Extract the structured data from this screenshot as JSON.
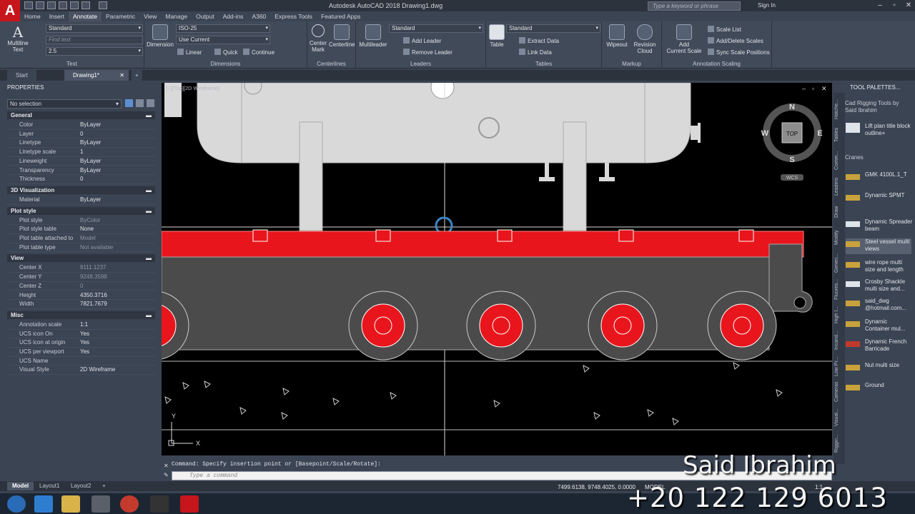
{
  "app": {
    "title": "Autodesk AutoCAD 2018    Drawing1.dwg",
    "logo": "A",
    "search_placeholder": "Type a keyword or phrase",
    "sign_in": "Sign In"
  },
  "ribbon_tabs": [
    "Home",
    "Insert",
    "Annotate",
    "Parametric",
    "View",
    "Manage",
    "Output",
    "Add-ins",
    "A360",
    "Express Tools",
    "Featured Apps"
  ],
  "ribbon": {
    "text": {
      "big_label": "Multiline\nText",
      "style": "Standard",
      "find": "Find text",
      "height": "2.5",
      "panel": "Text"
    },
    "dimensions": {
      "big_label": "Dimension",
      "style": "ISO-25",
      "layer": "Use Current",
      "linear": "Linear",
      "quick": "Quick",
      "continue": "Continue",
      "panel": "Dimensions"
    },
    "centerlines": {
      "mark": "Center\nMark",
      "centerline": "Centerline",
      "panel": "Centerlines"
    },
    "leaders": {
      "multileader": "Multileader",
      "style": "Standard",
      "add": "Add Leader",
      "remove": "Remove Leader",
      "panel": "Leaders"
    },
    "tables": {
      "table": "Table",
      "style": "Standard",
      "extract": "Extract Data",
      "link": "Link Data",
      "panel": "Tables"
    },
    "markup": {
      "wipeout": "Wipeout",
      "revcloud": "Revision\nCloud",
      "panel": "Markup"
    },
    "scaling": {
      "add": "Add\nCurrent Scale",
      "list": "Scale List",
      "adddel": "Add/Delete Scales",
      "sync": "Sync Scale Positions",
      "panel": "Annotation Scaling"
    }
  },
  "doc_tabs": {
    "start": "Start",
    "drawing": "Drawing1*"
  },
  "properties": {
    "header": "PROPERTIES",
    "selection": "No selection",
    "sections": [
      {
        "title": "General",
        "rows": [
          [
            "Color",
            "ByLayer"
          ],
          [
            "Layer",
            "0"
          ],
          [
            "Linetype",
            "ByLayer"
          ],
          [
            "Linetype scale",
            "1"
          ],
          [
            "Lineweight",
            "ByLayer"
          ],
          [
            "Transparency",
            "ByLayer"
          ],
          [
            "Thickness",
            "0"
          ]
        ]
      },
      {
        "title": "3D Visualization",
        "rows": [
          [
            "Material",
            "ByLayer"
          ]
        ]
      },
      {
        "title": "Plot style",
        "rows": [
          [
            "Plot style",
            "ByColor"
          ],
          [
            "Plot style table",
            "None"
          ],
          [
            "Plot table attached to",
            "Model"
          ],
          [
            "Plot table type",
            "Not available"
          ]
        ]
      },
      {
        "title": "View",
        "rows": [
          [
            "Center X",
            "8111.1237"
          ],
          [
            "Center Y",
            "9248.3598"
          ],
          [
            "Center Z",
            "0"
          ],
          [
            "Height",
            "4350.3716"
          ],
          [
            "Width",
            "7821.7679"
          ]
        ]
      },
      {
        "title": "Misc",
        "rows": [
          [
            "Annotation scale",
            "1:1"
          ],
          [
            "UCS icon On",
            "Yes"
          ],
          [
            "UCS icon at origin",
            "Yes"
          ],
          [
            "UCS per viewport",
            "Yes"
          ],
          [
            "UCS Name",
            ""
          ],
          [
            "Visual Style",
            "2D Wireframe"
          ]
        ]
      }
    ]
  },
  "viewport": {
    "label": "[−][Top][2D Wireframe]",
    "compass": {
      "n": "N",
      "s": "S",
      "e": "E",
      "w": "W",
      "top": "TOP",
      "wcs": "WCS"
    },
    "ucs_x": "X",
    "ucs_y": "Y"
  },
  "tool_palettes": {
    "header": "TOOL PALETTES...",
    "author": "Cad Rigging Tools by Said Ibrahim",
    "section": "Cranes",
    "side_tabs": [
      "Hatche...",
      "Tables",
      "Comm...",
      "Leaders",
      "Draw",
      "Modify",
      "Generi...",
      "Fluores...",
      "High I...",
      "Incand...",
      "Low Pr...",
      "Cameras",
      "Visual...",
      "Riggin..."
    ],
    "items": [
      "Lift plan title block outline+",
      "GMK 4100L.1_T",
      "Dynamic SPMT",
      "Dynamic Spreader beam",
      "Steel vessel multi views",
      "wire rope multi size and length",
      "Crosby Shackle multi size and...",
      "said_dwg @hotmail.com...",
      "Dynamic Container mul...",
      "Dynamic French Barricade",
      "Nut multi size",
      "Ground"
    ]
  },
  "command": {
    "history": "Command:  Specify insertion point or [Basepoint/Scale/Rotate]:",
    "placeholder": "Type a command"
  },
  "layout_tabs": [
    "Model",
    "Layout1",
    "Layout2"
  ],
  "status": {
    "coords": "7499.6138, 9748.4025, 0.0000",
    "model": "MODEL",
    "scale": "1:1"
  },
  "watermark": {
    "name": "Said Ibrahim",
    "phone": "+20 122 129 6013"
  },
  "colors": {
    "accent_red": "#e8161c",
    "title_bg": "#2d333d",
    "ribbon_bg": "#414a59"
  }
}
